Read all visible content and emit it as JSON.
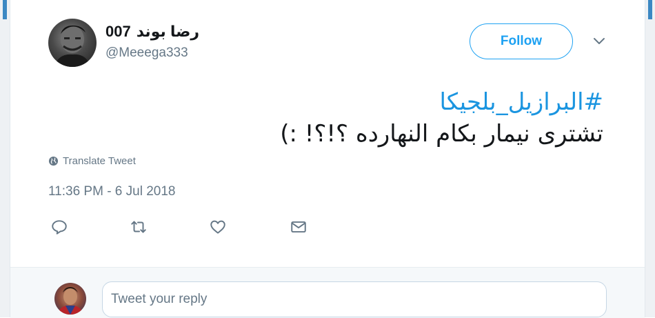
{
  "tweet": {
    "author": {
      "display_name": "رضا بوند",
      "display_number": "007",
      "handle": "@Meeega333"
    },
    "follow_label": "Follow",
    "hashtag": "#البرازيل_بلجيكا",
    "text": "تشترى نيمار بكام النهارده ؟!؟! :)",
    "translate_label": "Translate Tweet",
    "timestamp": "11:36 PM - 6 Jul 2018",
    "actions": [
      {
        "name": "reply",
        "icon": "reply-icon"
      },
      {
        "name": "retweet",
        "icon": "retweet-icon"
      },
      {
        "name": "like",
        "icon": "heart-icon"
      },
      {
        "name": "direct-message",
        "icon": "envelope-icon"
      }
    ]
  },
  "reply": {
    "placeholder": "Tweet your reply"
  },
  "colors": {
    "accent": "#1da1f2",
    "hashtag": "#1b95e0",
    "secondary_text": "#657786",
    "reply_bg": "#f5f8fa"
  }
}
